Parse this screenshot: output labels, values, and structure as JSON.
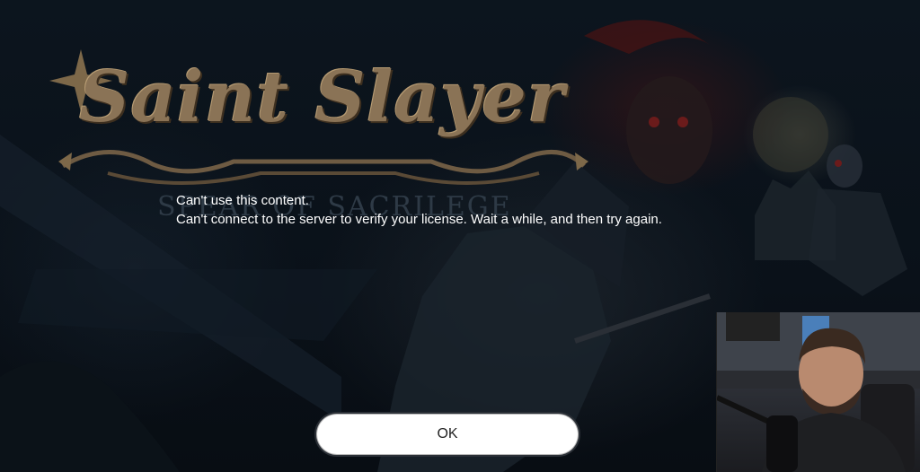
{
  "game": {
    "logo_title": "Saint Slayer",
    "logo_subtitle": "SPEAR OF SACRILEGE"
  },
  "dialog": {
    "title": "Can't use this content.",
    "message": "Can't connect to the server to verify your license. Wait a while, and then try again.",
    "ok_label": "OK"
  },
  "colors": {
    "background": "#0a1119",
    "logo_gold": "#8a7356",
    "text": "#ffffff",
    "button_bg": "#ffffff"
  },
  "overlay": {
    "webcam_icon": "person-webcam-icon"
  }
}
